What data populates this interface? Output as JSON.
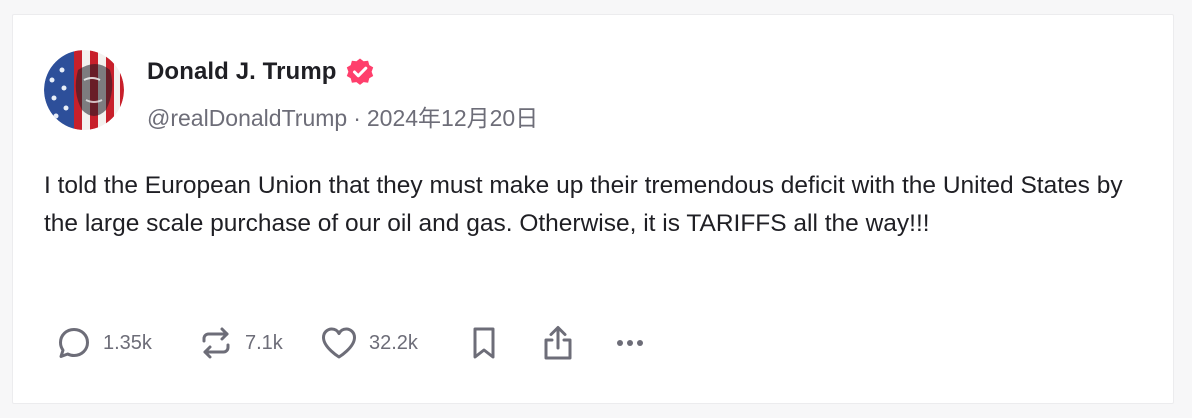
{
  "post": {
    "author": {
      "display_name": "Donald J. Trump",
      "handle": "@realDonaldTrump",
      "verified": true,
      "avatar_icon": "flag-portrait-avatar"
    },
    "separator": "·",
    "date": "2024年12月20日",
    "text": "I told the European Union that they must make up their tremendous deficit with the United States by the large scale purchase of our oil and gas. Otherwise, it is TARIFFS all the way!!!",
    "actions": {
      "reply_count": "1.35k",
      "repost_count": "7.1k",
      "like_count": "32.2k",
      "bookmark_icon": "bookmark-icon",
      "share_icon": "share-icon",
      "more_icon": "more-icon"
    }
  },
  "colors": {
    "verified_badge": "#ff3f6c",
    "text": "#1f1f24",
    "muted": "#6d6d78",
    "card_border": "#ececee",
    "page_background": "#f7f7f8"
  }
}
